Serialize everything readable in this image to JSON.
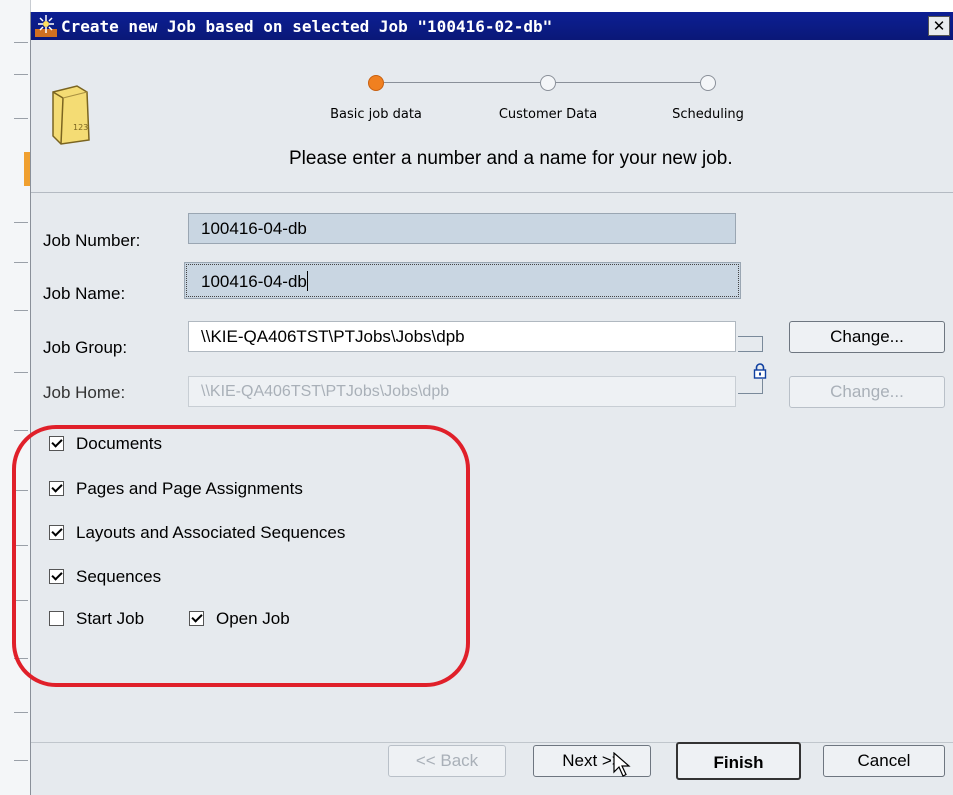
{
  "dialog": {
    "title": "Create new Job based on selected Job \"100416-02-db\"",
    "close_glyph": "✕"
  },
  "wizard": {
    "steps": [
      {
        "label": "Basic job data",
        "state": "current"
      },
      {
        "label": "Customer Data",
        "state": "pending"
      },
      {
        "label": "Scheduling",
        "state": "pending"
      }
    ],
    "subtitle": "Please enter a number and a name for your new job.",
    "current_color": "#f08020"
  },
  "form": {
    "job_number": {
      "label": "Job Number:",
      "value": "100416-04-db"
    },
    "job_name": {
      "label": "Job Name:",
      "value": "100416-04-db"
    },
    "job_group": {
      "label": "Job Group:",
      "value": "\\\\KIE-QA406TST\\PTJobs\\Jobs\\dpb",
      "button": "Change..."
    },
    "job_home": {
      "label": "Job Home:",
      "value": "\\\\KIE-QA406TST\\PTJobs\\Jobs\\dpb",
      "button": "Change..."
    }
  },
  "options": {
    "documents": {
      "label": "Documents",
      "checked": true
    },
    "pages": {
      "label": "Pages and Page Assignments",
      "checked": true
    },
    "layouts": {
      "label": "Layouts and Associated Sequences",
      "checked": true
    },
    "sequences": {
      "label": "Sequences",
      "checked": true
    },
    "start_job": {
      "label": "Start Job",
      "checked": false
    },
    "open_job": {
      "label": "Open Job",
      "checked": true
    }
  },
  "footer": {
    "back": "<< Back",
    "next": "Next >>",
    "finish": "Finish",
    "cancel": "Cancel"
  },
  "highlight_color": "#e0202a"
}
